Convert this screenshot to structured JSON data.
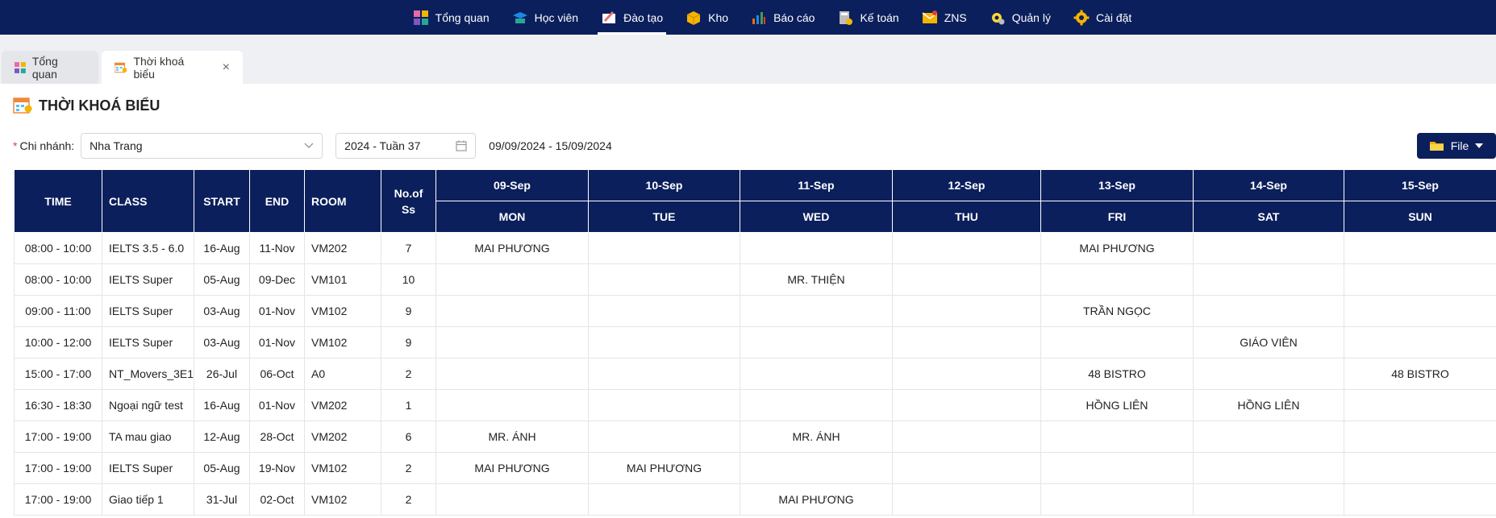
{
  "nav": {
    "items": [
      {
        "label": "Tổng quan",
        "icon": "dashboard-icon",
        "color": "#e86aa6",
        "active": false
      },
      {
        "label": "Học viên",
        "icon": "student-icon",
        "color": "#26a69a",
        "active": false
      },
      {
        "label": "Đào tạo",
        "icon": "training-icon",
        "color": "#e57373",
        "active": true
      },
      {
        "label": "Kho",
        "icon": "warehouse-icon",
        "color": "#f5b400",
        "active": false
      },
      {
        "label": "Báo cáo",
        "icon": "report-icon",
        "color": "#ef6c00",
        "active": false
      },
      {
        "label": "Kế toán",
        "icon": "accounting-icon",
        "color": "#bdbdbd",
        "active": false
      },
      {
        "label": "ZNS",
        "icon": "mail-icon",
        "color": "#f5b400",
        "active": false
      },
      {
        "label": "Quản lý",
        "icon": "manage-icon",
        "color": "#fdd835",
        "active": false
      },
      {
        "label": "Cài đặt",
        "icon": "gear-icon",
        "color": "#f5b400",
        "active": false
      }
    ]
  },
  "tabs": [
    {
      "label": "Tổng quan",
      "icon": "dashboard-icon"
    },
    {
      "label": "Thời khoá biểu",
      "icon": "calendar-icon",
      "close": "×"
    }
  ],
  "page": {
    "title": "THỜI KHOÁ BIỂU"
  },
  "filters": {
    "branch_label": "Chi nhánh",
    "branch_req": "*",
    "branch_colon": ":",
    "branch_value": "Nha Trang",
    "week_value": "2024 - Tuần 37",
    "range_text": "09/09/2024 - 15/09/2024",
    "file_label": "File"
  },
  "table": {
    "headers": {
      "time": "TIME",
      "class": "CLASS",
      "start": "START",
      "end": "END",
      "room": "ROOM",
      "sessions": "No.of Ss"
    },
    "dates": [
      "09-Sep",
      "10-Sep",
      "11-Sep",
      "12-Sep",
      "13-Sep",
      "14-Sep",
      "15-Sep"
    ],
    "days": [
      "MON",
      "TUE",
      "WED",
      "THU",
      "FRI",
      "SAT",
      "SUN"
    ],
    "rows": [
      {
        "time": "08:00 - 10:00",
        "class": "IELTS 3.5 - 6.0",
        "start": "16-Aug",
        "end": "11-Nov",
        "room": "VM202",
        "sessions": "7",
        "days": [
          "MAI PHƯƠNG",
          "",
          "",
          "",
          "MAI PHƯƠNG",
          "",
          ""
        ]
      },
      {
        "time": "08:00 - 10:00",
        "class": "IELTS Super",
        "start": "05-Aug",
        "end": "09-Dec",
        "room": "VM101",
        "sessions": "10",
        "days": [
          "",
          "",
          "MR. THIỆN",
          "",
          "",
          "",
          ""
        ]
      },
      {
        "time": "09:00 - 11:00",
        "class": "IELTS Super",
        "start": "03-Aug",
        "end": "01-Nov",
        "room": "VM102",
        "sessions": "9",
        "days": [
          "",
          "",
          "",
          "",
          "TRẦN NGỌC",
          "",
          ""
        ]
      },
      {
        "time": "10:00 - 12:00",
        "class": "IELTS Super",
        "start": "03-Aug",
        "end": "01-Nov",
        "room": "VM102",
        "sessions": "9",
        "days": [
          "",
          "",
          "",
          "",
          "",
          "GIÁO VIÊN",
          ""
        ]
      },
      {
        "time": "15:00 - 17:00",
        "class": "NT_Movers_3E1",
        "start": "26-Jul",
        "end": "06-Oct",
        "room": "A0",
        "sessions": "2",
        "days": [
          "",
          "",
          "",
          "",
          "48 BISTRO",
          "",
          "48 BISTRO"
        ]
      },
      {
        "time": "16:30 - 18:30",
        "class": "Ngoại ngữ test",
        "start": "16-Aug",
        "end": "01-Nov",
        "room": "VM202",
        "sessions": "1",
        "days": [
          "",
          "",
          "",
          "",
          "HỒNG LIÊN",
          "HỒNG LIÊN",
          ""
        ]
      },
      {
        "time": "17:00 - 19:00",
        "class": "TA mau giao",
        "start": "12-Aug",
        "end": "28-Oct",
        "room": "VM202",
        "sessions": "6",
        "days": [
          "MR. ÁNH",
          "",
          "MR. ÁNH",
          "",
          "",
          "",
          ""
        ]
      },
      {
        "time": "17:00 - 19:00",
        "class": "IELTS Super",
        "start": "05-Aug",
        "end": "19-Nov",
        "room": "VM102",
        "sessions": "2",
        "days": [
          "MAI PHƯƠNG",
          "MAI PHƯƠNG",
          "",
          "",
          "",
          "",
          ""
        ]
      },
      {
        "time": "17:00 - 19:00",
        "class": "Giao tiếp 1",
        "start": "31-Jul",
        "end": "02-Oct",
        "room": "VM102",
        "sessions": "2",
        "days": [
          "",
          "",
          "MAI PHƯƠNG",
          "",
          "",
          "",
          ""
        ]
      }
    ]
  },
  "colors": {
    "navy": "#0b1f5c",
    "required": "#e23b3b",
    "tabbar": "#eef0f3"
  }
}
